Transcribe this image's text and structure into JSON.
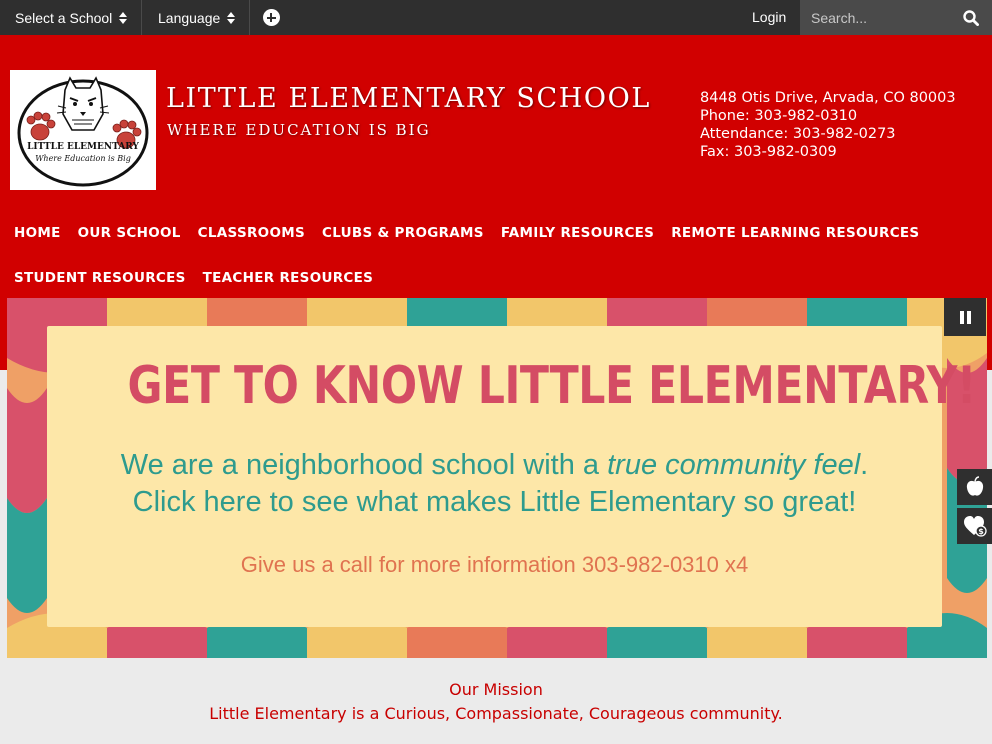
{
  "topbar": {
    "school_select": "Select a School",
    "language": "Language",
    "login": "Login",
    "search_placeholder": "Search..."
  },
  "header": {
    "logo_text": "LITTLE ELEMENTARY",
    "logo_subtext": "Where Education is Big",
    "school_name": "LITTLE ELEMENTARY SCHOOL",
    "tagline": "WHERE EDUCATION IS BIG",
    "contact": {
      "address": "8448 Otis Drive, Arvada, CO 80003",
      "phone": "Phone: 303-982-0310",
      "attendance": "Attendance: 303-982-0273",
      "fax": "Fax: 303-982-0309"
    }
  },
  "nav": {
    "row1": [
      "HOME",
      "OUR SCHOOL",
      "CLASSROOMS",
      "CLUBS & PROGRAMS",
      "FAMILY RESOURCES",
      "REMOTE LEARNING RESOURCES"
    ],
    "row2": [
      "STUDENT RESOURCES",
      "TEACHER RESOURCES"
    ]
  },
  "hero": {
    "title": "GET TO KNOW LITTLE ELEMENTARY!",
    "line1_a": "We are a neighborhood school with a ",
    "line1_em": "true community feel",
    "line1_b": ".",
    "line2": "Click here to see what makes Little Elementary so great!",
    "call": "Give us a call for more information 303-982-0310 x4"
  },
  "side_tabs": [
    "apple-icon",
    "heart-dollar-icon"
  ],
  "mission": {
    "title": "Our Mission",
    "text": "Little Elementary is a Curious, Compassionate, Courageous community."
  },
  "colors": {
    "brand_red": "#d10000",
    "topbar": "#2f2f2f",
    "hero_title": "#d44c64",
    "hero_teal": "#2e9b8e",
    "hero_card": "#fde7a8"
  }
}
